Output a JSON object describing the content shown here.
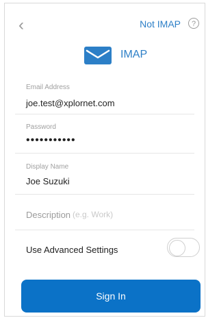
{
  "nav": {
    "back_label": "‹",
    "not_imap_label": "Not IMAP",
    "help_label": "?"
  },
  "header": {
    "title": "IMAP",
    "icon": "mail-icon",
    "accent_color": "#2c7fc7"
  },
  "form": {
    "email": {
      "label": "Email Address",
      "value": "joe.test@xplornet.com"
    },
    "password": {
      "label": "Password",
      "value": "•••••••••••"
    },
    "display_name": {
      "label": "Display Name",
      "value": "Joe Suzuki"
    },
    "description": {
      "label": "Description",
      "placeholder": "(e.g. Work)"
    },
    "advanced": {
      "label": "Use Advanced Settings",
      "enabled": false
    }
  },
  "actions": {
    "sign_in_label": "Sign In",
    "button_color": "#0b72c7"
  }
}
